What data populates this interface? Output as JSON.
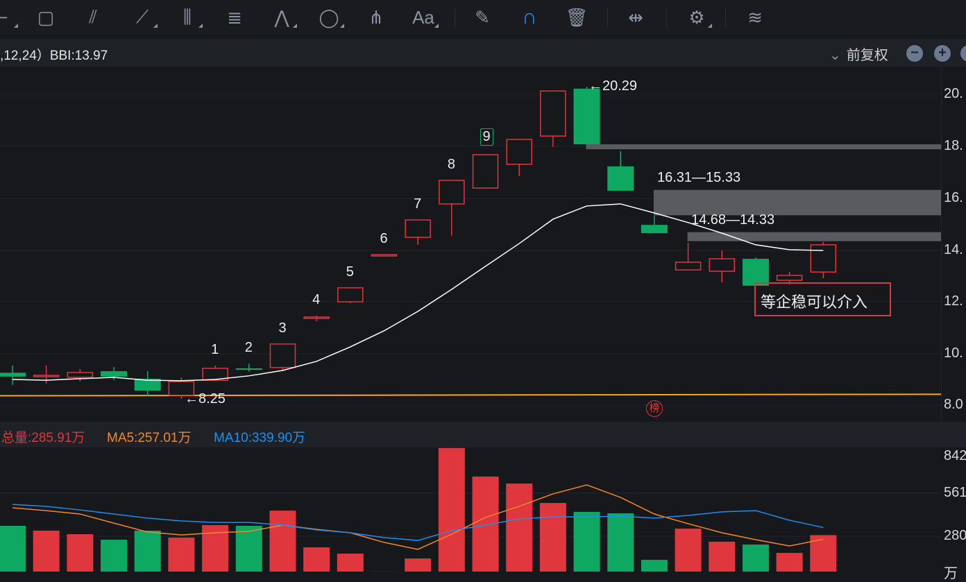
{
  "toolbar": {
    "items": [
      "line-tool-icon",
      "rectangle-icon",
      "fan-icon",
      "parallel-channel-icon",
      "vertical-lines-icon",
      "gann-icon",
      "wave-icon",
      "ellipse-icon",
      "pitchfork-icon",
      "text-icon",
      "eraser-icon",
      "magnet-icon",
      "trash-icon",
      "range-icon",
      "settings-icon",
      "layers-icon"
    ],
    "text_label": "Aa"
  },
  "indicator": {
    "bbi_text": ",12,24）BBI:13.97",
    "adjust": "前复权",
    "zoom_out": "−",
    "zoom_in": "+"
  },
  "price_axis": [
    "20.",
    "18.",
    "16.",
    "14.",
    "12.",
    "10.",
    "8.0"
  ],
  "volume_axis": [
    "842",
    "561",
    "280",
    "万"
  ],
  "volume_header": {
    "total": "总量:285.91万",
    "ma5": "MA5:257.01万",
    "ma10": "MA10:339.90万"
  },
  "annotations": {
    "high": "←20.29",
    "low": "←8.25",
    "zone1": "16.31—15.33",
    "zone2": "14.68—14.33",
    "note": "等企稳可以介入",
    "badge": "榜",
    "counts": [
      "1",
      "2",
      "3",
      "4",
      "5",
      "6",
      "7",
      "8",
      "9"
    ]
  },
  "colors": {
    "up": "#e0363e",
    "down": "#0ea863",
    "bbi": "#ffffff",
    "ma5": "#f5872b",
    "ma10": "#1e8ff0",
    "support": "#f5a623",
    "zone": "#5a5b5e"
  },
  "chart_data": {
    "type": "candlestick",
    "ohlc": [
      [
        9.25,
        9.53,
        8.78,
        9.1
      ],
      [
        9.1,
        9.53,
        8.83,
        9.15
      ],
      [
        9.07,
        9.39,
        8.91,
        9.26
      ],
      [
        9.31,
        9.47,
        8.96,
        9.1
      ],
      [
        9.02,
        9.31,
        8.35,
        8.56
      ],
      [
        8.38,
        9.07,
        8.25,
        8.91
      ],
      [
        8.96,
        9.53,
        8.96,
        9.42
      ],
      [
        9.42,
        9.6,
        9.29,
        9.39
      ],
      [
        9.45,
        10.36,
        9.34,
        10.36
      ],
      [
        11.35,
        11.46,
        11.24,
        11.4
      ],
      [
        11.99,
        12.53,
        11.94,
        12.53
      ],
      [
        13.76,
        13.81,
        13.76,
        13.81
      ],
      [
        14.48,
        15.15,
        14.19,
        15.15
      ],
      [
        15.77,
        16.68,
        14.54,
        16.68
      ],
      [
        16.38,
        17.67,
        16.38,
        17.67
      ],
      [
        17.3,
        18.26,
        16.84,
        18.26
      ],
      [
        18.39,
        20.13,
        17.97,
        20.13
      ],
      [
        20.22,
        20.29,
        18.07,
        18.07
      ],
      [
        17.22,
        17.8,
        16.28,
        16.28
      ],
      [
        14.96,
        15.31,
        14.64,
        14.64
      ],
      [
        13.22,
        14.27,
        13.22,
        13.52
      ],
      [
        13.17,
        13.97,
        12.74,
        13.65
      ],
      [
        13.65,
        13.7,
        12.61,
        12.61
      ],
      [
        12.82,
        13.14,
        12.66,
        13.01
      ],
      [
        13.14,
        14.3,
        12.9,
        14.19
      ]
    ],
    "bbi": [
      8.99,
      8.96,
      9.02,
      9.07,
      8.96,
      8.94,
      8.99,
      9.13,
      9.34,
      9.69,
      10.25,
      10.87,
      11.62,
      12.47,
      13.36,
      14.24,
      15.18,
      15.69,
      15.77,
      15.42,
      15.05,
      14.64,
      14.19,
      14.0,
      13.97
    ],
    "support_line": [
      8.36,
      8.42
    ],
    "zones": [
      [
        17.88,
        18.07,
        17
      ],
      [
        15.33,
        16.31,
        19
      ],
      [
        14.33,
        14.68,
        20
      ]
    ],
    "volume": [
      352,
      318,
      293,
      254,
      318,
      269,
      357,
      352,
      459,
      200,
      156,
      30,
      122,
      900,
      699,
      650,
      513,
      450,
      440,
      112,
      332,
      240,
      220,
      161,
      286
    ],
    "ma5": [
      479,
      459,
      435,
      371,
      308,
      288,
      303,
      313,
      357,
      327,
      303,
      235,
      186,
      293,
      411,
      489,
      577,
      640,
      552,
      435,
      367,
      303,
      254,
      210,
      257
    ],
    "ma10": [
      503,
      489,
      464,
      435,
      406,
      386,
      376,
      376,
      357,
      323,
      303,
      269,
      249,
      318,
      357,
      401,
      415,
      415,
      420,
      406,
      425,
      450,
      459,
      391,
      340
    ],
    "price_range": [
      8,
      20
    ],
    "volume_range": [
      0,
      842
    ]
  }
}
